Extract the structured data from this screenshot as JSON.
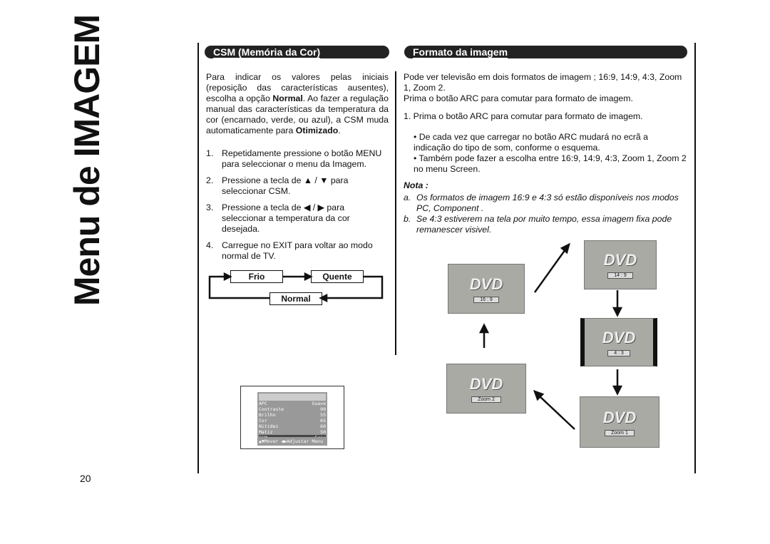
{
  "side_title": "Menu de IMAGEM",
  "page_number": "20",
  "left": {
    "header": "CSM (Memória da Cor)",
    "intro_1": "Para indicar os valores pelas iniciais (reposição das características ausentes), escolha a opção ",
    "intro_bold_1": "Normal",
    "intro_2": ". Ao fazer a regulação manual das características da temperatura da cor (encarnado, verde, ou azul), a CSM muda automaticamente para ",
    "intro_bold_2": "Otimizado",
    "intro_3": ".",
    "steps": [
      {
        "n": "1.",
        "text": "Repetidamente pressione o botão MENU para seleccionar o menu da Imagem."
      },
      {
        "n": "2.",
        "text": "Pressione a tecla de ▲ / ▼ para seleccionar CSM."
      },
      {
        "n": "3.",
        "text": "Pressione a tecla de ◀ / ▶ para seleccionar a temperatura da cor desejada."
      },
      {
        "n": "4.",
        "text": "Carregue no EXIT para voltar ao modo normal de TV."
      }
    ],
    "cycle": [
      "Frio",
      "Quente",
      "Normal"
    ],
    "osd": {
      "rows": [
        [
          "APC",
          "Suave"
        ],
        [
          "Contraste",
          "90"
        ],
        [
          "Brilho",
          "55"
        ],
        [
          "Cor",
          "65"
        ],
        [
          "Nitidez",
          "60"
        ],
        [
          "Matiz",
          "50"
        ],
        [
          "CSM",
          "Frio"
        ]
      ],
      "footer": "▲▼Mover ◀▶Adjustar Menu"
    }
  },
  "right": {
    "header": "Formato da imagem",
    "p1": "Pode ver televisão em dois formatos de imagem ; 16:9, 14:9, 4:3, Zoom 1, Zoom 2.",
    "p2": "Prima o botão ARC para comutar para formato de imagem.",
    "step1": "1. Prima o botão ARC para comutar para formato de imagem.",
    "b1": "• De cada vez que carregar no botão ARC mudará no ecrã a indicação do tipo de som, conforme o esquema.",
    "b2": "• Também pode fazer a escolha entre 16:9, 14:9, 4:3, Zoom 1, Zoom 2 no menu Screen.",
    "nota": "Nota :",
    "na": "a.",
    "a": "Os formatos de imagem 16:9 e 4:3 só estão disponíveis nos modos PC, Component .",
    "nb": "b.",
    "b": "Se 4:3 estiverem na tela por muito tempo, essa imagem fixa pode remanescer visivel.",
    "screens": [
      "16 : 9",
      "14 : 9",
      "4 : 3",
      "Zoom 2",
      "Zoom 1"
    ],
    "logo": "DVD"
  }
}
